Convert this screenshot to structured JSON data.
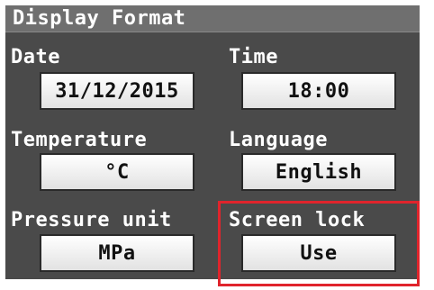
{
  "title": "Display Format",
  "fields": {
    "date": {
      "label": "Date",
      "value": "31/12/2015"
    },
    "time": {
      "label": "Time",
      "value": "18:00"
    },
    "temperature": {
      "label": "Temperature",
      "value": "°C"
    },
    "language": {
      "label": "Language",
      "value": "English"
    },
    "pressure_unit": {
      "label": "Pressure unit",
      "value": "MPa"
    },
    "screen_lock": {
      "label": "Screen lock",
      "value": "Use"
    }
  },
  "colors": {
    "screen_background": "#4a4a4a",
    "title_bar": "#6f6f6f",
    "highlight": "#e0242c"
  }
}
